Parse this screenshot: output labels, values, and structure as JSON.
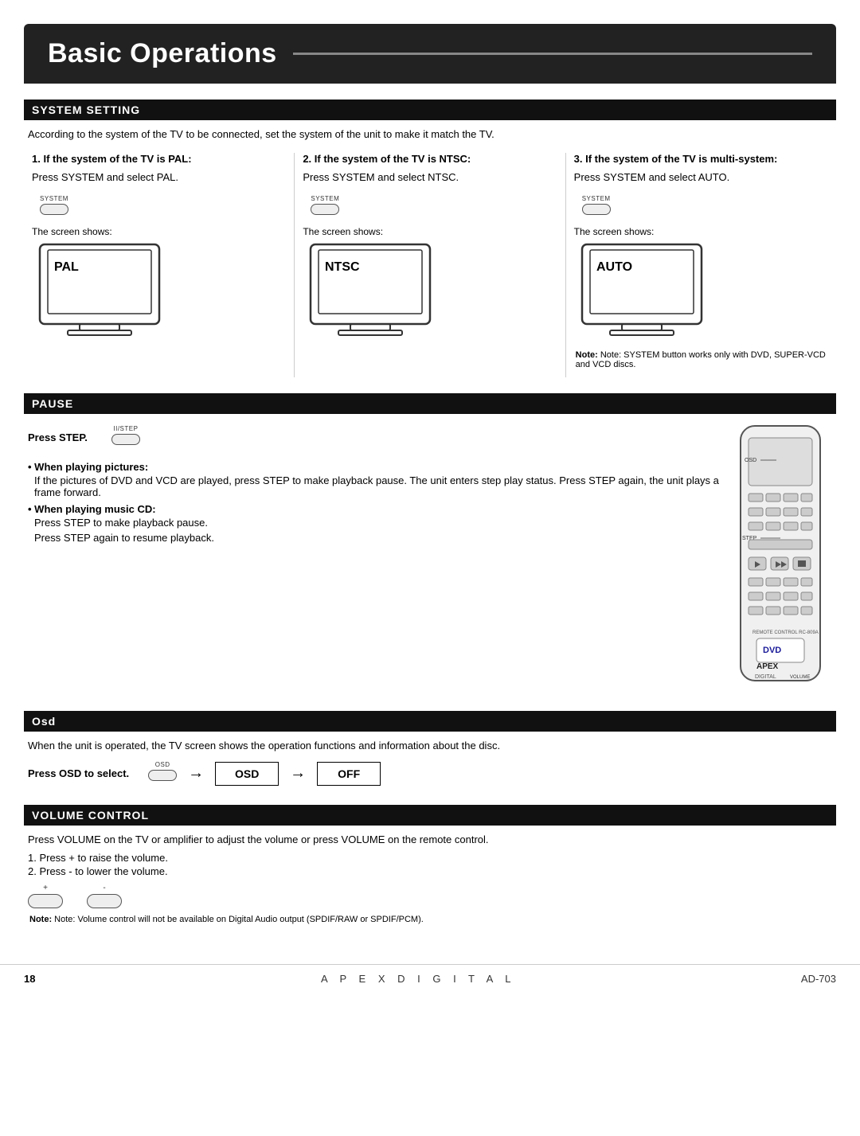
{
  "header": {
    "title": "Basic Operations",
    "line": true
  },
  "sections": {
    "system_setting": {
      "header": "SYSTEM SETTING",
      "description": "According to the system of the TV to be connected, set the system of the unit to make it match the TV.",
      "columns": [
        {
          "title": "1. If the system of the TV is PAL:",
          "desc": "Press SYSTEM and select PAL.",
          "btn_label": "SYSTEM",
          "screen_label": "The screen shows:",
          "screen_text": "PAL"
        },
        {
          "title": "2. If the system of the TV is NTSC:",
          "desc": "Press SYSTEM and select NTSC.",
          "btn_label": "SYSTEM",
          "screen_label": "The screen shows:",
          "screen_text": "NTSC"
        },
        {
          "title": "3. If the system of the TV is multi-system:",
          "desc": "Press SYSTEM and select AUTO.",
          "btn_label": "SYSTEM",
          "screen_label": "The screen shows:",
          "screen_text": "AUTO",
          "note": "Note: SYSTEM button works only with DVD, SUPER-VCD and VCD discs."
        }
      ]
    },
    "pause": {
      "header": "PAUSE",
      "press_step": "Press STEP.",
      "btn_label": "II/STEP",
      "when_playing_pictures_title": "When playing pictures:",
      "when_playing_pictures_body": "If the pictures of DVD and VCD are played, press STEP to make playback pause. The unit enters step play status. Press STEP again, the unit plays a frame forward.",
      "when_playing_music_title": "When playing music CD:",
      "when_playing_music_line1": "Press STEP to make playback pause.",
      "when_playing_music_line2": "Press STEP again to resume playback."
    },
    "osd": {
      "header": "Osd",
      "description": "When the unit is operated, the TV screen shows the operation functions and information about the disc.",
      "press_label": "Press OSD to select.",
      "btn_label": "OSD",
      "flow": [
        "OSD",
        "OFF"
      ]
    },
    "volume_control": {
      "header": "VOLUME CONTROL",
      "desc1": "Press VOLUME on the TV or amplifier to adjust the volume or press VOLUME on the remote control.",
      "items": [
        "1. Press + to raise the volume.",
        "2. Press - to lower the volume."
      ],
      "plus_label": "+",
      "minus_label": "-",
      "note": "Note: Volume control will not be available on Digital Audio output (SPDIF/RAW or SPDIF/PCM)."
    }
  },
  "footer": {
    "page_num": "18",
    "brand": "A  P  E  X     D  I  G  I  T  A  L",
    "model": "AD-703"
  }
}
